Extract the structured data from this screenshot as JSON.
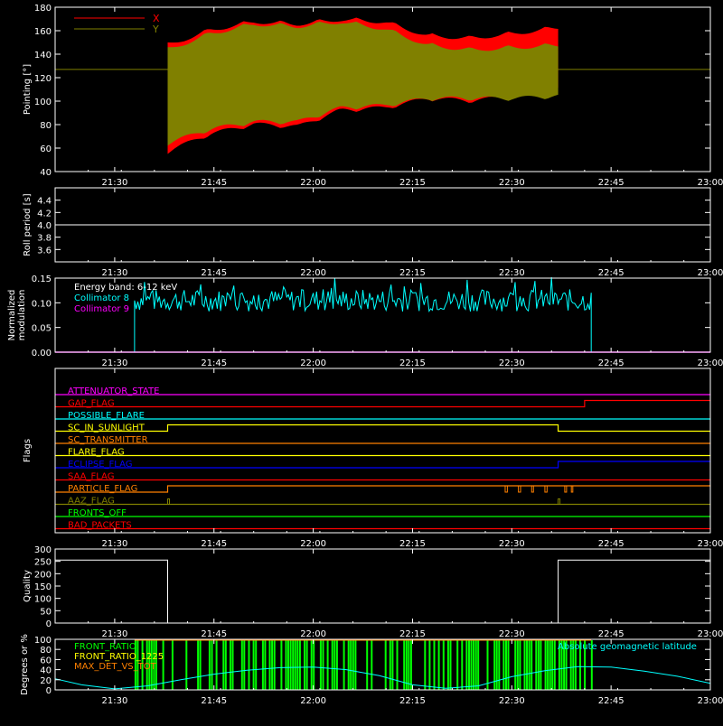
{
  "colors": {
    "background": "#000000",
    "axis": "#ffffff",
    "x_series": "#ff0000",
    "y_series": "#808000",
    "collimator8": "#00ffff",
    "collimator9": "#ff00ff",
    "front_ratio": "#00ff00",
    "geomag": "#00ffff"
  },
  "chart_data": [
    {
      "id": "pointing",
      "type": "area",
      "xlabel": "",
      "ylabel": "Pointing [°]",
      "ylim": [
        40,
        180
      ],
      "yticks": [
        "40",
        "60",
        "80",
        "100",
        "120",
        "140",
        "160",
        "180"
      ],
      "xticks": [
        "21:30",
        "21:45",
        "22:00",
        "22:15",
        "22:30",
        "22:45",
        "23:00"
      ],
      "xlim": [
        "21:21",
        "23:00"
      ],
      "data_span": [
        "21:38",
        "22:37"
      ],
      "series": [
        {
          "name": "X",
          "color": "#ff0000",
          "upper": [
            150,
            163,
            170,
            168,
            172,
            170,
            158,
            156,
            160,
            165
          ],
          "lower": [
            55,
            70,
            78,
            76,
            90,
            92,
            100,
            98,
            102,
            108
          ]
        },
        {
          "name": "Y",
          "color": "#808000",
          "upper": [
            146,
            160,
            168,
            166,
            170,
            164,
            150,
            146,
            148,
            150
          ],
          "lower": [
            62,
            74,
            80,
            80,
            92,
            94,
            100,
            100,
            100,
            102
          ]
        }
      ],
      "reference_line": 127,
      "grid": false,
      "legend": "top-left"
    },
    {
      "id": "roll_period",
      "type": "line",
      "ylabel": "Roll period [s]",
      "ylim": [
        3.4,
        4.6
      ],
      "yticks": [
        "3.6",
        "3.8",
        "4.0",
        "4.2",
        "4.4"
      ],
      "xticks": [
        "21:30",
        "21:45",
        "22:00",
        "22:15",
        "22:30",
        "22:45",
        "23:00"
      ],
      "values": [
        4.0,
        4.0
      ],
      "grid": false
    },
    {
      "id": "modulation",
      "type": "line",
      "ylabel": "Normalized modulation",
      "ylim": [
        0,
        0.15
      ],
      "yticks": [
        "0.00",
        "0.05",
        "0.10",
        "0.15"
      ],
      "xticks": [
        "21:30",
        "21:45",
        "22:00",
        "22:15",
        "22:30",
        "22:45",
        "23:00"
      ],
      "annotation": "Energy band: 6-12 keV",
      "data_span": [
        "21:33",
        "22:42"
      ],
      "series": [
        {
          "name": "Collimator 8",
          "color": "#00ffff",
          "typical": 0.105,
          "range": [
            0.08,
            0.15
          ]
        },
        {
          "name": "Collimator 9",
          "color": "#ff00ff",
          "typical": 0.0
        }
      ],
      "legend": "top-left",
      "grid": false
    },
    {
      "id": "flags",
      "type": "line",
      "ylabel": "Flags",
      "xticks": [
        "21:30",
        "21:45",
        "22:00",
        "22:15",
        "22:30",
        "22:45",
        "23:00"
      ],
      "flags": [
        {
          "name": "ATTENUATOR_STATE",
          "color": "#ff00ff",
          "transitions": []
        },
        {
          "name": "GAP_FLAG",
          "color": "#ff0000",
          "transitions": [
            [
              "22:41",
              1
            ]
          ]
        },
        {
          "name": "POSSIBLE_FLARE",
          "color": "#00ffff",
          "transitions": []
        },
        {
          "name": "SC_IN_SUNLIGHT",
          "color": "#ffff00",
          "transitions": [
            [
              "21:38",
              1
            ],
            [
              "22:37",
              0
            ]
          ]
        },
        {
          "name": "SC_TRANSMITTER",
          "color": "#ff8000",
          "transitions": []
        },
        {
          "name": "FLARE_FLAG",
          "color": "#ffff00",
          "transitions": []
        },
        {
          "name": "ECLIPSE_FLAG",
          "color": "#0000ff",
          "transitions": [
            [
              "21:38",
              0
            ],
            [
              "22:37",
              1
            ]
          ]
        },
        {
          "name": "SAA_FLAG",
          "color": "#ff0000",
          "transitions": []
        },
        {
          "name": "PARTICLE_FLAG",
          "color": "#ff8000",
          "transitions": [
            [
              "21:38",
              1
            ]
          ]
        },
        {
          "name": "AAZ_FLAG",
          "color": "#808000",
          "transitions": []
        },
        {
          "name": "FRONTS_OFF",
          "color": "#00ff00",
          "transitions": []
        },
        {
          "name": "BAD_PACKETS",
          "color": "#ff0000",
          "transitions": []
        }
      ],
      "grid": false
    },
    {
      "id": "quality",
      "type": "line",
      "ylabel": "Quality",
      "ylim": [
        0,
        300
      ],
      "yticks": [
        "0",
        "50",
        "100",
        "150",
        "200",
        "250",
        "300"
      ],
      "xticks": [
        "21:30",
        "21:45",
        "22:00",
        "22:15",
        "22:30",
        "22:45",
        "23:00"
      ],
      "points": [
        [
          "21:21",
          255
        ],
        [
          "21:38",
          255
        ],
        [
          "21:38",
          0
        ],
        [
          "22:37",
          0
        ],
        [
          "22:37",
          255
        ],
        [
          "23:00",
          255
        ]
      ],
      "grid": false
    },
    {
      "id": "geomag",
      "type": "line",
      "ylabel": "Degrees or %",
      "ylim": [
        0,
        100
      ],
      "yticks": [
        "0",
        "20",
        "40",
        "60",
        "80",
        "100"
      ],
      "xticks": [
        "21:30",
        "21:45",
        "22:00",
        "22:15",
        "22:30",
        "22:45",
        "23:00"
      ],
      "series": [
        {
          "name": "FRONT_RATIO",
          "color": "#00ff00"
        },
        {
          "name": "FRONT_RATIO_1225",
          "color": "#ffff00"
        },
        {
          "name": "MAX_DET_VS_TOT",
          "color": "#ff8000"
        },
        {
          "name": "Absolute geomagnetic latitude",
          "color": "#00ffff",
          "x": [
            "21:21",
            "21:25",
            "21:30",
            "21:35",
            "21:40",
            "21:45",
            "21:50",
            "21:55",
            "22:00",
            "22:05",
            "22:10",
            "22:15",
            "22:20",
            "22:25",
            "22:30",
            "22:35",
            "22:40",
            "22:45",
            "22:50",
            "22:55",
            "23:00"
          ],
          "values": [
            22,
            10,
            2,
            8,
            20,
            31,
            39,
            44,
            45,
            40,
            28,
            10,
            3,
            8,
            26,
            38,
            46,
            45,
            37,
            27,
            13
          ]
        }
      ],
      "legend": "top-left",
      "grid": false
    }
  ]
}
